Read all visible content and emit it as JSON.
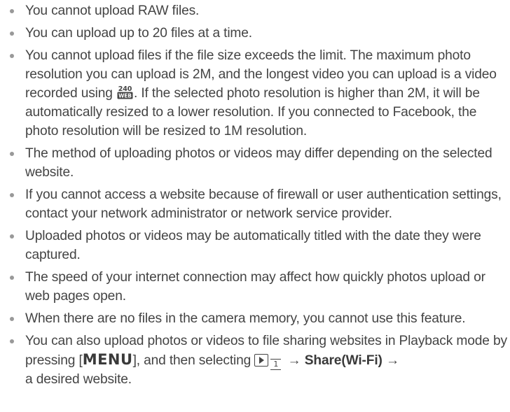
{
  "items": [
    {
      "text": "You cannot upload RAW files."
    },
    {
      "text": "You can upload up to 20 files at a time."
    },
    {
      "text_before_icon": "You cannot upload files if the file size exceeds the limit. The maximum photo resolution you can upload is 2M, and the longest video you can upload is a video recorded using ",
      "icon": "video-240-web-icon",
      "icon_text_top": "240",
      "icon_text_bottom": "WEB",
      "text_after_icon": ". If the selected photo resolution is higher than 2M, it will be automatically resized to a lower resolution. If you connected to Facebook, the photo resolution will be resized to 1M resolution."
    },
    {
      "text": "The method of uploading photos or videos may differ depending on the selected website."
    },
    {
      "text": "If you cannot access a website because of firewall or user authentication settings, contact your network administrator or network service provider."
    },
    {
      "text": "Uploaded photos or videos may be automatically titled with the date they were captured."
    },
    {
      "text": "The speed of your internet connection may affect how quickly photos upload or web pages open."
    },
    {
      "text": "When there are no files in the camera memory, you cannot use this feature."
    },
    {
      "text_before_key": "You can also upload photos or videos to file sharing websites in Playback mode by pressing [",
      "key": "MENU",
      "text_after_key": "], and then selecting ",
      "playback_icon": "playback-icon",
      "tab_number": "1",
      "arrow1": " → ",
      "menu_option": "Share(Wi-Fi)",
      "arrow2": " →",
      "text_end": "a desired website."
    }
  ]
}
